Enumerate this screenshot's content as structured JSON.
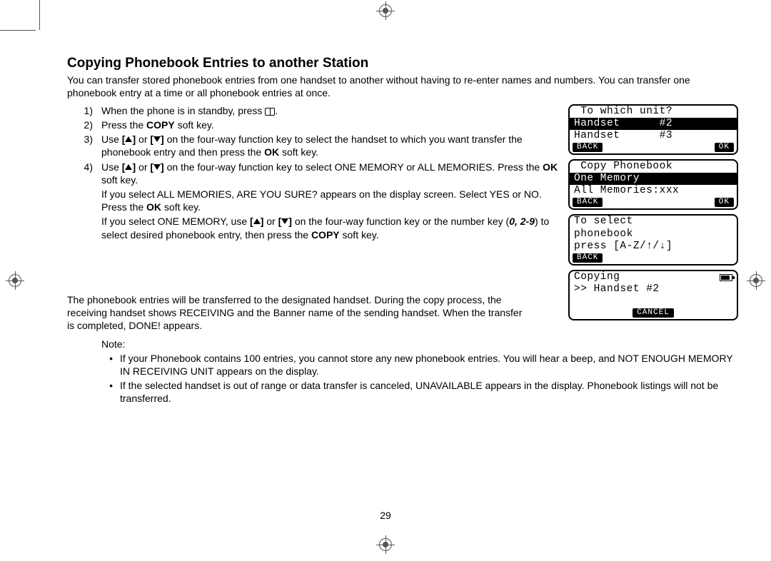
{
  "heading": "Copying Phonebook Entries to another Station",
  "intro": "You can transfer stored phonebook entries from one handset to another without having to re-enter names and numbers. You can transfer one phonebook entry at a time or all phonebook entries at once.",
  "steps": {
    "s1_a": "When the phone is in standby, press ",
    "s1_b": ".",
    "s2_a": "Press the ",
    "s2_bold": "COPY",
    "s2_b": " soft key.",
    "s3_a": "Use ",
    "s3_b": " or ",
    "s3_c": " on the four-way function key to select the handset to which you want transfer the phonebook entry and then press the ",
    "s3_bold": "OK",
    "s3_d": " soft key.",
    "s4_a": "Use ",
    "s4_b": " or ",
    "s4_c": " on the four-way function key to select ONE MEMORY or ALL MEMORIES. Press the ",
    "s4_bold": "OK",
    "s4_d": " soft key.",
    "s4_sub1_a": "If you select ALL MEMORIES, ARE YOU SURE? appears on the display screen. Select YES or NO. Press the ",
    "s4_sub1_bold": "OK",
    "s4_sub1_b": " soft key.",
    "s4_sub2_a": "If you select ONE MEMORY, use ",
    "s4_sub2_b": " or ",
    "s4_sub2_c": " on the four-way function key or the number key (",
    "s4_sub2_ital": "0, 2-9",
    "s4_sub2_d": ") to select desired phonebook entry, then press the ",
    "s4_sub2_bold": "COPY",
    "s4_sub2_e": " soft key."
  },
  "after": "The phonebook entries will be transferred to the designated handset. During the copy process, the receiving handset shows RECEIVING and the Banner name of the sending handset. When the transfer is completed, DONE! appears.",
  "note_label": "Note:",
  "notes": [
    "If your Phonebook contains 100 entries, you cannot store any new phonebook entries. You will hear a beep, and NOT ENOUGH MEMORY IN RECEIVING UNIT appears on the display.",
    "If the selected handset is out of range or data transfer is canceled, UNAVAILABLE appears in the display. Phonebook listings will not be transferred."
  ],
  "screens": {
    "s1": {
      "l1": " To which unit?",
      "l2": "Handset      #2",
      "l3": "Handset      #3",
      "back": "BACK",
      "ok": "OK"
    },
    "s2": {
      "l1": " Copy Phonebook",
      "l2": "One Memory",
      "l3": "All Memories:xxx",
      "back": "BACK",
      "ok": "OK"
    },
    "s3": {
      "l1": "To select",
      "l2": "phonebook",
      "l3": "press [A-Z/↑/↓]",
      "back": "BACK"
    },
    "s4": {
      "l1": "Copying",
      "l2": ">> Handset #2",
      "cancel": "CANCEL"
    }
  },
  "page_number": "29"
}
